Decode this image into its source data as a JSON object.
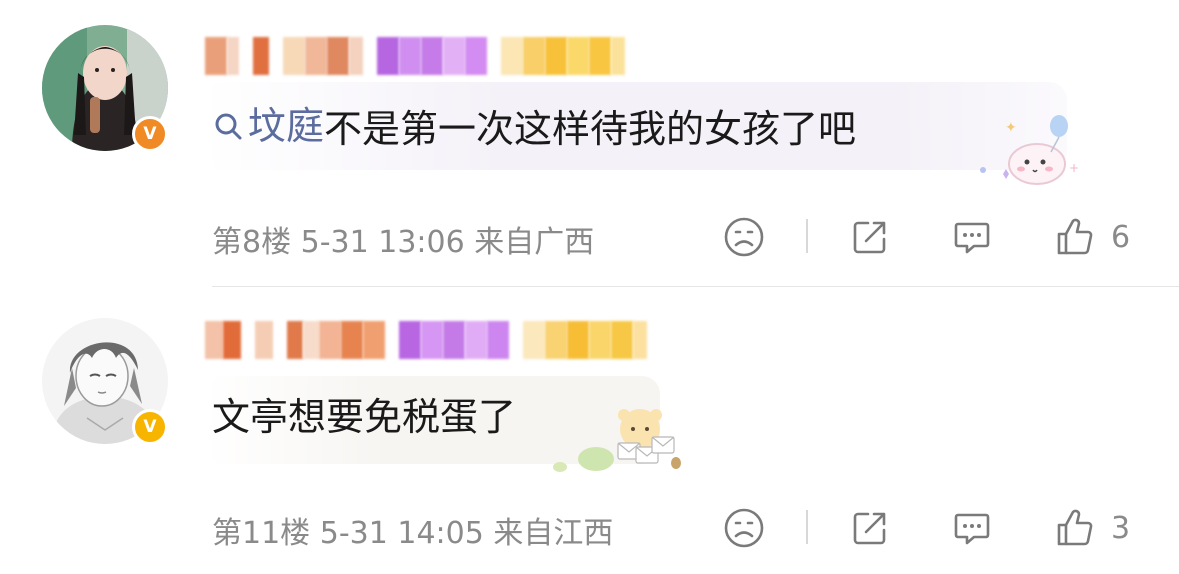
{
  "comments": [
    {
      "content_topic": "坟庭",
      "content_text": "不是第一次这样待我的女孩了吧",
      "floor": "第8楼",
      "date": "5-31 13:06",
      "location": "来自广西",
      "like_count": "6",
      "verified_badge": "V",
      "icons": [
        "dislike-face-icon",
        "share-icon",
        "comment-icon",
        "thumbs-up-icon"
      ]
    },
    {
      "content_text": "文亭想要免税蛋了",
      "floor": "第11楼",
      "date": "5-31 14:05",
      "location": "来自江西",
      "like_count": "3",
      "verified_badge": "V",
      "icons": [
        "dislike-face-icon",
        "share-icon",
        "comment-icon",
        "thumbs-up-icon"
      ]
    }
  ],
  "colors": {
    "meta_text": "#8a8a8a",
    "topic_link": "#5b6c9e",
    "badge_orange": "#f08a24",
    "badge_yellow": "#f7b500"
  }
}
